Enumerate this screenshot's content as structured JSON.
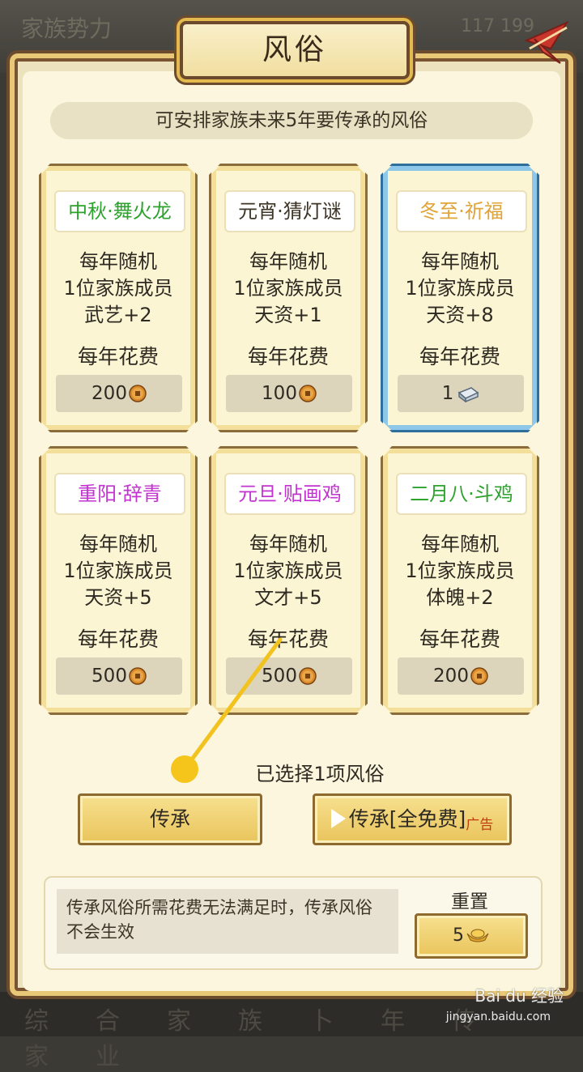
{
  "background": {
    "top_text": "家族势力",
    "top_right": "117  199",
    "bottom_text": "综合家族卜年传家业"
  },
  "dialog": {
    "title": "风俗",
    "hint": "可安排家族未来5年要传承的风俗"
  },
  "colors": {
    "green": "#2da22d",
    "orange": "#e0a43a",
    "purple": "#c233cf",
    "dark": "#3c3426",
    "selected_border": "#2f6f9c",
    "button_gold": "#e9c45b"
  },
  "customs": [
    {
      "name": "中秋·舞火龙",
      "name_color": "green",
      "desc1": "每年随机",
      "desc2": "1位家族成员",
      "effect": "武艺+2",
      "cost_label": "每年花费",
      "cost": "200",
      "currency": "copper-coin-icon",
      "selected": false
    },
    {
      "name": "元宵·猜灯谜",
      "name_color": "dark",
      "desc1": "每年随机",
      "desc2": "1位家族成员",
      "effect": "天资+1",
      "cost_label": "每年花费",
      "cost": "100",
      "currency": "copper-coin-icon",
      "selected": false
    },
    {
      "name": "冬至·祈福",
      "name_color": "orange",
      "desc1": "每年随机",
      "desc2": "1位家族成员",
      "effect": "天资+8",
      "cost_label": "每年花费",
      "cost": "1",
      "currency": "silver-ingot-icon",
      "selected": true
    },
    {
      "name": "重阳·辞青",
      "name_color": "purple",
      "desc1": "每年随机",
      "desc2": "1位家族成员",
      "effect": "天资+5",
      "cost_label": "每年花费",
      "cost": "500",
      "currency": "copper-coin-icon",
      "selected": false
    },
    {
      "name": "元旦·贴画鸡",
      "name_color": "purple",
      "desc1": "每年随机",
      "desc2": "1位家族成员",
      "effect": "文才+5",
      "cost_label": "每年花费",
      "cost": "500",
      "currency": "copper-coin-icon",
      "selected": false
    },
    {
      "name": "二月八·斗鸡",
      "name_color": "green",
      "desc1": "每年随机",
      "desc2": "1位家族成员",
      "effect": "体魄+2",
      "cost_label": "每年花费",
      "cost": "200",
      "currency": "copper-coin-icon",
      "selected": false
    }
  ],
  "selection": {
    "count_text": "已选择1项风俗"
  },
  "buttons": {
    "inherit": "传承",
    "inherit_free": "传承[全免费]",
    "ad_tag": "广告"
  },
  "footer": {
    "note": "传承风俗所需花费无法满足时，传承风俗不会生效",
    "reset_label": "重置",
    "reset_cost": "5",
    "reset_currency": "gold-ingot-icon"
  },
  "watermark": {
    "brand": "Bai du 经验",
    "url": "jingyan.baidu.com"
  }
}
